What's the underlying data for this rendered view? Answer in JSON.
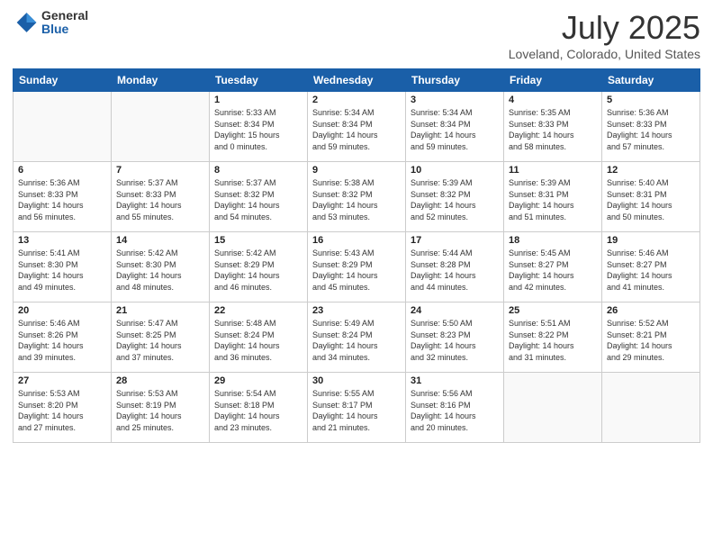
{
  "logo": {
    "general": "General",
    "blue": "Blue"
  },
  "title": "July 2025",
  "subtitle": "Loveland, Colorado, United States",
  "headers": [
    "Sunday",
    "Monday",
    "Tuesday",
    "Wednesday",
    "Thursday",
    "Friday",
    "Saturday"
  ],
  "weeks": [
    [
      {
        "day": "",
        "info": ""
      },
      {
        "day": "",
        "info": ""
      },
      {
        "day": "1",
        "info": "Sunrise: 5:33 AM\nSunset: 8:34 PM\nDaylight: 15 hours\nand 0 minutes."
      },
      {
        "day": "2",
        "info": "Sunrise: 5:34 AM\nSunset: 8:34 PM\nDaylight: 14 hours\nand 59 minutes."
      },
      {
        "day": "3",
        "info": "Sunrise: 5:34 AM\nSunset: 8:34 PM\nDaylight: 14 hours\nand 59 minutes."
      },
      {
        "day": "4",
        "info": "Sunrise: 5:35 AM\nSunset: 8:33 PM\nDaylight: 14 hours\nand 58 minutes."
      },
      {
        "day": "5",
        "info": "Sunrise: 5:36 AM\nSunset: 8:33 PM\nDaylight: 14 hours\nand 57 minutes."
      }
    ],
    [
      {
        "day": "6",
        "info": "Sunrise: 5:36 AM\nSunset: 8:33 PM\nDaylight: 14 hours\nand 56 minutes."
      },
      {
        "day": "7",
        "info": "Sunrise: 5:37 AM\nSunset: 8:33 PM\nDaylight: 14 hours\nand 55 minutes."
      },
      {
        "day": "8",
        "info": "Sunrise: 5:37 AM\nSunset: 8:32 PM\nDaylight: 14 hours\nand 54 minutes."
      },
      {
        "day": "9",
        "info": "Sunrise: 5:38 AM\nSunset: 8:32 PM\nDaylight: 14 hours\nand 53 minutes."
      },
      {
        "day": "10",
        "info": "Sunrise: 5:39 AM\nSunset: 8:32 PM\nDaylight: 14 hours\nand 52 minutes."
      },
      {
        "day": "11",
        "info": "Sunrise: 5:39 AM\nSunset: 8:31 PM\nDaylight: 14 hours\nand 51 minutes."
      },
      {
        "day": "12",
        "info": "Sunrise: 5:40 AM\nSunset: 8:31 PM\nDaylight: 14 hours\nand 50 minutes."
      }
    ],
    [
      {
        "day": "13",
        "info": "Sunrise: 5:41 AM\nSunset: 8:30 PM\nDaylight: 14 hours\nand 49 minutes."
      },
      {
        "day": "14",
        "info": "Sunrise: 5:42 AM\nSunset: 8:30 PM\nDaylight: 14 hours\nand 48 minutes."
      },
      {
        "day": "15",
        "info": "Sunrise: 5:42 AM\nSunset: 8:29 PM\nDaylight: 14 hours\nand 46 minutes."
      },
      {
        "day": "16",
        "info": "Sunrise: 5:43 AM\nSunset: 8:29 PM\nDaylight: 14 hours\nand 45 minutes."
      },
      {
        "day": "17",
        "info": "Sunrise: 5:44 AM\nSunset: 8:28 PM\nDaylight: 14 hours\nand 44 minutes."
      },
      {
        "day": "18",
        "info": "Sunrise: 5:45 AM\nSunset: 8:27 PM\nDaylight: 14 hours\nand 42 minutes."
      },
      {
        "day": "19",
        "info": "Sunrise: 5:46 AM\nSunset: 8:27 PM\nDaylight: 14 hours\nand 41 minutes."
      }
    ],
    [
      {
        "day": "20",
        "info": "Sunrise: 5:46 AM\nSunset: 8:26 PM\nDaylight: 14 hours\nand 39 minutes."
      },
      {
        "day": "21",
        "info": "Sunrise: 5:47 AM\nSunset: 8:25 PM\nDaylight: 14 hours\nand 37 minutes."
      },
      {
        "day": "22",
        "info": "Sunrise: 5:48 AM\nSunset: 8:24 PM\nDaylight: 14 hours\nand 36 minutes."
      },
      {
        "day": "23",
        "info": "Sunrise: 5:49 AM\nSunset: 8:24 PM\nDaylight: 14 hours\nand 34 minutes."
      },
      {
        "day": "24",
        "info": "Sunrise: 5:50 AM\nSunset: 8:23 PM\nDaylight: 14 hours\nand 32 minutes."
      },
      {
        "day": "25",
        "info": "Sunrise: 5:51 AM\nSunset: 8:22 PM\nDaylight: 14 hours\nand 31 minutes."
      },
      {
        "day": "26",
        "info": "Sunrise: 5:52 AM\nSunset: 8:21 PM\nDaylight: 14 hours\nand 29 minutes."
      }
    ],
    [
      {
        "day": "27",
        "info": "Sunrise: 5:53 AM\nSunset: 8:20 PM\nDaylight: 14 hours\nand 27 minutes."
      },
      {
        "day": "28",
        "info": "Sunrise: 5:53 AM\nSunset: 8:19 PM\nDaylight: 14 hours\nand 25 minutes."
      },
      {
        "day": "29",
        "info": "Sunrise: 5:54 AM\nSunset: 8:18 PM\nDaylight: 14 hours\nand 23 minutes."
      },
      {
        "day": "30",
        "info": "Sunrise: 5:55 AM\nSunset: 8:17 PM\nDaylight: 14 hours\nand 21 minutes."
      },
      {
        "day": "31",
        "info": "Sunrise: 5:56 AM\nSunset: 8:16 PM\nDaylight: 14 hours\nand 20 minutes."
      },
      {
        "day": "",
        "info": ""
      },
      {
        "day": "",
        "info": ""
      }
    ]
  ]
}
